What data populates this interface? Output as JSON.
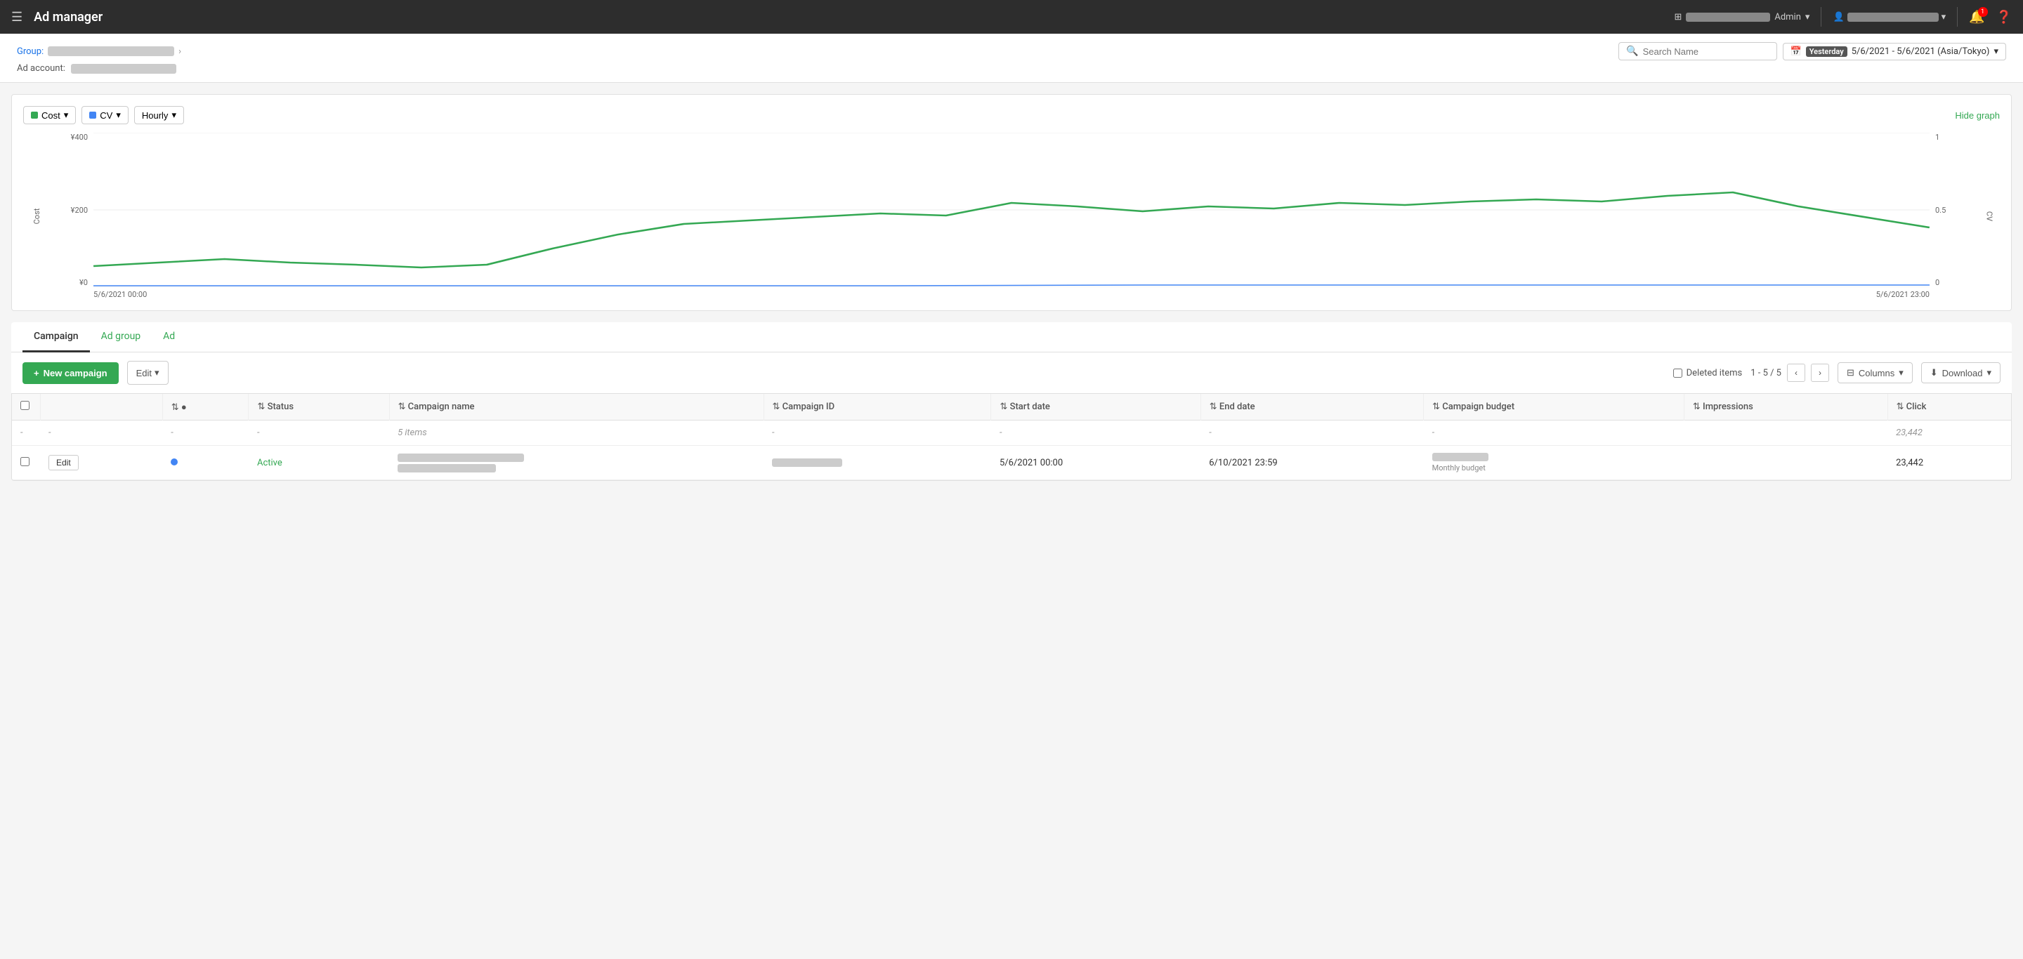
{
  "topnav": {
    "menu_icon": "☰",
    "title": "Ad manager",
    "account_label": "████ · ████████",
    "admin_label": "Admin",
    "user_label": "████████████",
    "bell_count": "1",
    "help_icon": "?"
  },
  "header": {
    "group_label": "Group:",
    "group_value": "████████ ████████████",
    "breadcrumb_sep": "›",
    "ad_account_label": "Ad account:",
    "ad_account_value": "████ · ████████",
    "search_placeholder": "Search Name",
    "date_badge": "Yesterday",
    "date_range": "5/6/2021 - 5/6/2021 (Asia/Tokyo)",
    "date_dropdown": "▾"
  },
  "chart": {
    "cost_label": "Cost",
    "cv_label": "CV",
    "hourly_label": "Hourly",
    "hide_graph": "Hide graph",
    "y_left_label": "Cost",
    "y_right_label": "CV",
    "y_left_max": "¥400",
    "y_left_mid": "¥200",
    "y_left_min": "¥0",
    "y_right_max": "1",
    "y_right_mid": "0.5",
    "y_right_min": "0",
    "x_start": "5/6/2021 00:00",
    "x_end": "5/6/2021 23:00"
  },
  "tabs": [
    {
      "id": "campaign",
      "label": "Campaign",
      "active": true,
      "green": false
    },
    {
      "id": "ad-group",
      "label": "Ad group",
      "active": false,
      "green": true
    },
    {
      "id": "ad",
      "label": "Ad",
      "active": false,
      "green": true
    }
  ],
  "toolbar": {
    "new_campaign_label": "+ New campaign",
    "edit_label": "Edit",
    "edit_dropdown": "▾",
    "deleted_items_label": "Deleted items",
    "pagination_label": "1 - 5 / 5",
    "prev_icon": "‹",
    "next_icon": "›",
    "columns_label": "Columns",
    "download_label": "Download"
  },
  "table": {
    "columns": [
      {
        "id": "checkbox",
        "label": ""
      },
      {
        "id": "empty1",
        "label": ""
      },
      {
        "id": "dot",
        "label": "●"
      },
      {
        "id": "status",
        "label": "Status"
      },
      {
        "id": "campaign_name",
        "label": "Campaign name"
      },
      {
        "id": "campaign_id",
        "label": "Campaign ID"
      },
      {
        "id": "start_date",
        "label": "Start date"
      },
      {
        "id": "end_date",
        "label": "End date"
      },
      {
        "id": "campaign_budget",
        "label": "Campaign budget"
      },
      {
        "id": "impressions",
        "label": "Impressions"
      },
      {
        "id": "clicks",
        "label": "Click"
      }
    ],
    "summary_row": {
      "col1": "-",
      "col2": "-",
      "col3": "-",
      "col4": "-",
      "col5": "5 items",
      "col6": "-",
      "col7": "-",
      "col8": "-",
      "col9": "-",
      "col10": "23,442"
    },
    "rows": [
      {
        "edit_btn": "Edit",
        "dot_color": "#4285f4",
        "status": "Active",
        "campaign_name": "████████ ████████ █████",
        "campaign_id": "██████████",
        "start_date": "5/6/2021 00:00",
        "end_date": "6/10/2021 23:59",
        "campaign_budget": "███████",
        "budget_label": "Monthly budget",
        "impressions": "",
        "clicks": "23,442"
      }
    ]
  },
  "footer": {
    "items_label": "5 items"
  }
}
